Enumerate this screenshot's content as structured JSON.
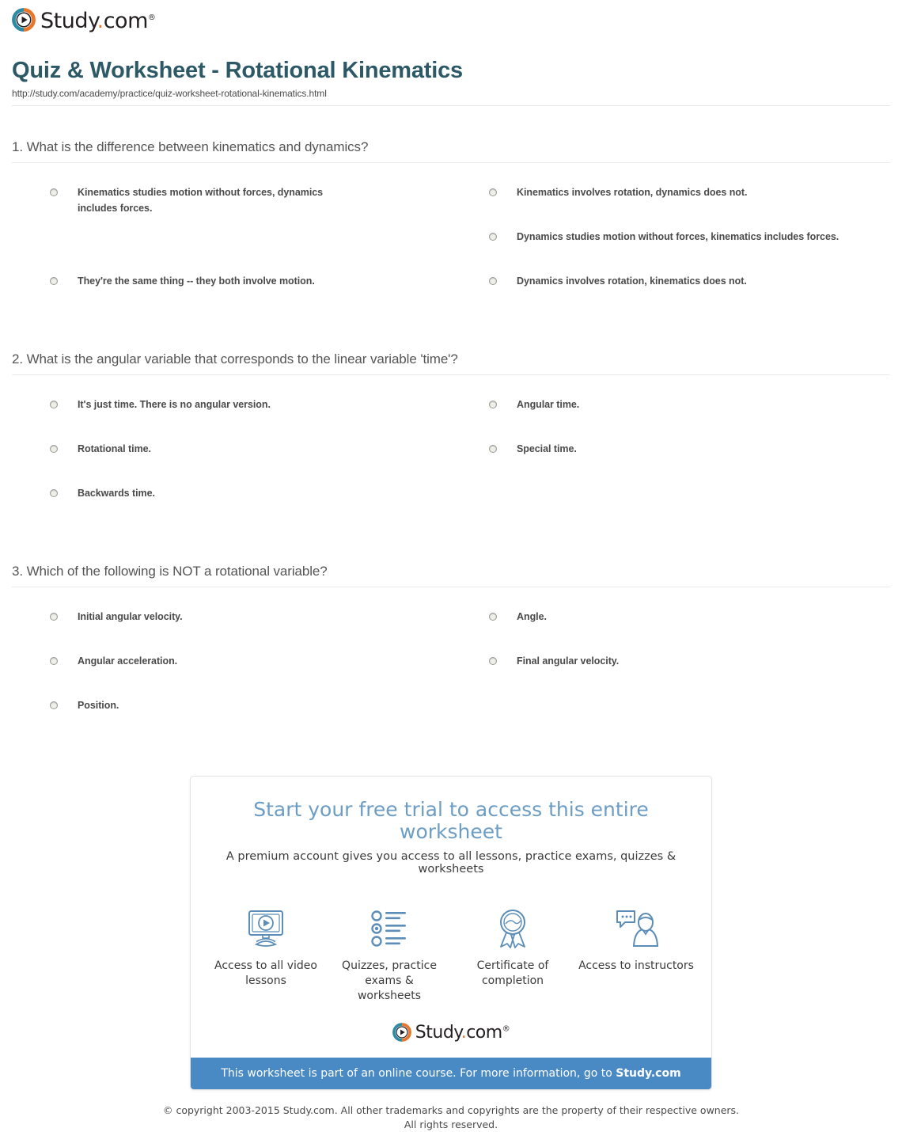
{
  "brand": {
    "name_main": "Study",
    "name_dot": ".",
    "name_suffix": "com",
    "trademark": "®",
    "mark_icon": "play-circle-icon",
    "teal": "#2d8ba3",
    "orange": "#e8762c"
  },
  "header": {
    "title": "Quiz & Worksheet - Rotational Kinematics",
    "url": "http://study.com/academy/practice/quiz-worksheet-rotational-kinematics.html",
    "title_color": "#2d5866"
  },
  "questions": [
    {
      "number": "1.",
      "text": "1. What is the difference between kinematics and dynamics?",
      "answers": [
        "Kinematics studies motion without forces, dynamics includes forces.",
        "Kinematics involves rotation, dynamics does not.",
        "",
        "Dynamics studies motion without forces, kinematics includes forces.",
        "They're the same thing -- they both involve motion.",
        "Dynamics involves rotation, kinematics does not."
      ]
    },
    {
      "number": "2.",
      "text": "2. What is the angular variable that corresponds to the linear variable 'time'?",
      "answers": [
        "It's just time. There is no angular version.",
        "Angular time.",
        "Rotational time.",
        "Special time.",
        "Backwards time.",
        ""
      ]
    },
    {
      "number": "3.",
      "text": "3. Which of the following is NOT a rotational variable?",
      "answers": [
        "Initial angular velocity.",
        "Angle.",
        "Angular acceleration.",
        "Final angular velocity.",
        "Position.",
        ""
      ]
    }
  ],
  "promo": {
    "headline": "Start your free trial to access this entire worksheet",
    "subheadline": "A premium account gives you access to all lessons, practice exams, quizzes & worksheets",
    "features": [
      {
        "icon": "monitor-play-icon",
        "label": "Access to all video lessons"
      },
      {
        "icon": "quiz-list-icon",
        "label": "Quizzes, practice exams & worksheets"
      },
      {
        "icon": "certificate-ribbon-icon",
        "label": "Certificate of completion"
      },
      {
        "icon": "instructor-chat-icon",
        "label": "Access to instructors"
      }
    ],
    "bar_text": "This worksheet is part of an online course. For more information, go to ",
    "bar_link": "Study.com",
    "bar_color": "#4a8ac4",
    "headline_color": "#6d9dc5"
  },
  "footer": {
    "line1": "© copyright 2003-2015 Study.com. All other trademarks and copyrights are the property of their respective owners.",
    "line2": "All rights reserved."
  }
}
